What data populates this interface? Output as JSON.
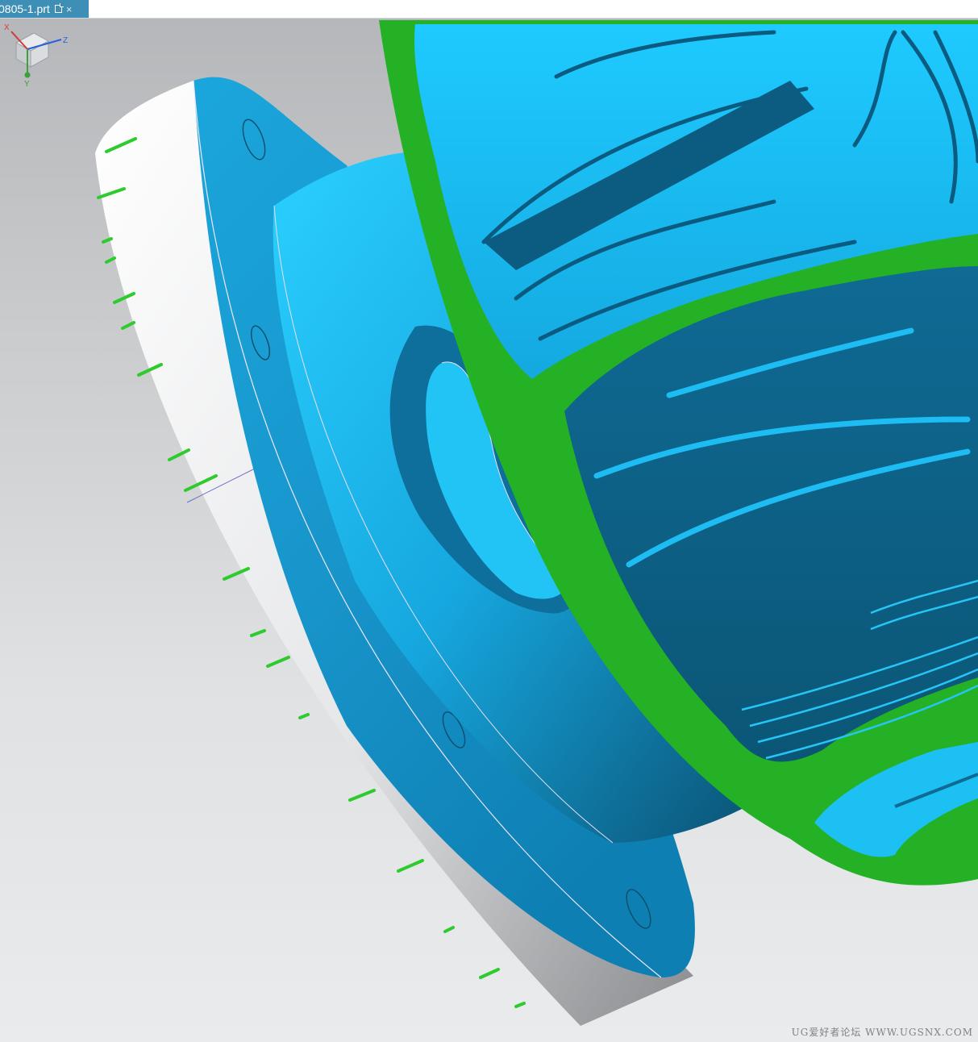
{
  "tab": {
    "title": "0805-1.prt",
    "close_symbol": "×",
    "pin_icon": "restore-window-icon"
  },
  "viewport": {
    "background_top": "#b5b7ba",
    "background_bottom": "#e9ebed",
    "model_face_color": "#1cbdf0",
    "model_shadow_color": "#0b5d80",
    "section_color": "#27b427",
    "rim_color": "#f4f4f4"
  },
  "triad": {
    "x_label": "X",
    "y_label": "Y",
    "z_label": "Z"
  },
  "watermark": "UG爱好者论坛 WWW.UGSNX.COM"
}
